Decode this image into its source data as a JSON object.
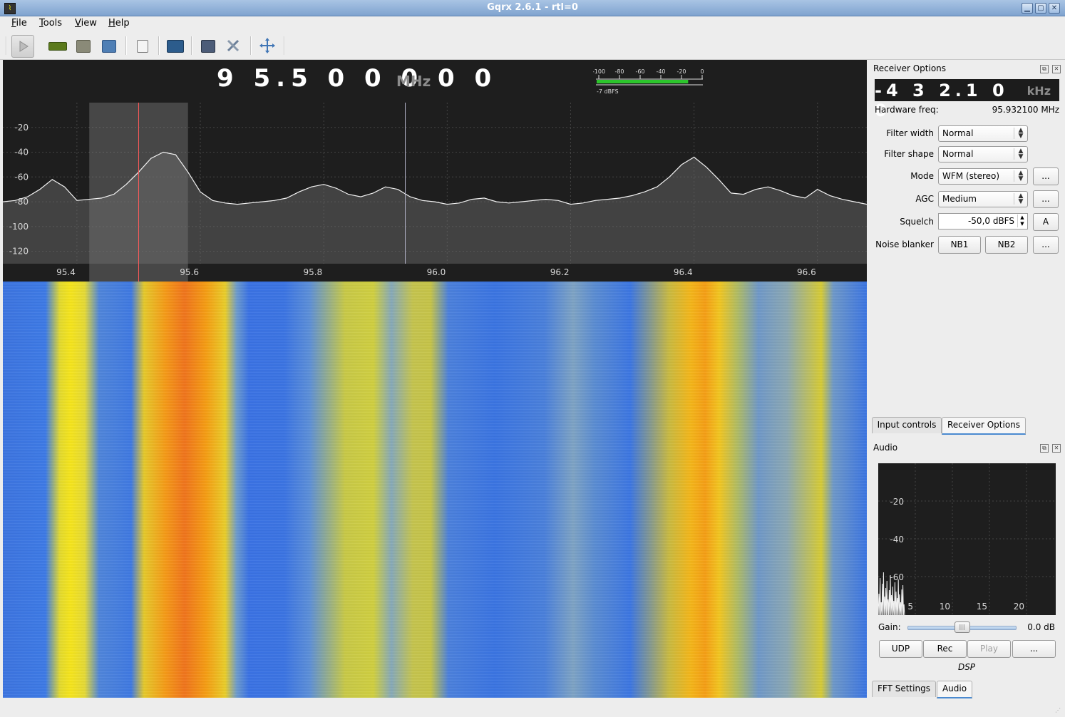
{
  "window": {
    "title": "Gqrx 2.6.1 - rtl=0",
    "controls": [
      "minimize-icon",
      "maximize-icon",
      "close-icon"
    ]
  },
  "menu": [
    "File",
    "Tools",
    "View",
    "Help"
  ],
  "toolbar": {
    "buttons": [
      "play-icon",
      "hardware-icon",
      "open-icon",
      "save-icon",
      "bookmark-icon",
      "dsp-icon",
      "remote-icon",
      "settings-icon",
      "fit-icon"
    ]
  },
  "plot": {
    "frequency": "9 5.5 0 0   0 0 0",
    "unit": "MHz",
    "meter": {
      "ticks": [
        "-100",
        "-80",
        "-60",
        "-40",
        "-20",
        "0"
      ],
      "level_label": "-7 dBFS",
      "level_dbfs": -7
    },
    "y_ticks": [
      "-20",
      "-40",
      "-60",
      "-80",
      "-100",
      "-120"
    ],
    "x_ticks": [
      "95.4",
      "95.6",
      "95.8",
      "96.0",
      "96.2",
      "96.4",
      "96.6"
    ]
  },
  "chart_data": {
    "type": "line",
    "x": [
      95.28,
      95.3,
      95.32,
      95.34,
      95.36,
      95.38,
      95.4,
      95.42,
      95.44,
      95.46,
      95.48,
      95.5,
      95.52,
      95.54,
      95.56,
      95.58,
      95.6,
      95.62,
      95.64,
      95.66,
      95.68,
      95.7,
      95.72,
      95.74,
      95.76,
      95.78,
      95.8,
      95.82,
      95.84,
      95.86,
      95.88,
      95.9,
      95.92,
      95.94,
      95.96,
      95.98,
      96.0,
      96.02,
      96.04,
      96.06,
      96.08,
      96.1,
      96.12,
      96.14,
      96.16,
      96.18,
      96.2,
      96.22,
      96.24,
      96.26,
      96.28,
      96.3,
      96.32,
      96.34,
      96.36,
      96.38,
      96.4,
      96.42,
      96.44,
      96.46,
      96.48,
      96.5,
      96.52,
      96.54,
      96.56,
      96.58,
      96.6,
      96.62,
      96.64,
      96.66,
      96.68
    ],
    "values": [
      -80,
      -79,
      -76,
      -70,
      -62,
      -68,
      -79,
      -78,
      -77,
      -74,
      -66,
      -56,
      -45,
      -40,
      -42,
      -56,
      -72,
      -79,
      -81,
      -82,
      -81,
      -80,
      -79,
      -77,
      -72,
      -68,
      -66,
      -69,
      -74,
      -76,
      -73,
      -68,
      -70,
      -76,
      -79,
      -80,
      -82,
      -81,
      -78,
      -77,
      -80,
      -81,
      -80,
      -79,
      -78,
      -79,
      -82,
      -81,
      -79,
      -78,
      -77,
      -75,
      -72,
      -68,
      -60,
      -50,
      -44,
      -52,
      -62,
      -73,
      -74,
      -70,
      -68,
      -71,
      -75,
      -77,
      -70,
      -75,
      -78,
      -80,
      -82
    ],
    "xlabel": "",
    "ylabel": "",
    "ylim": [
      -130,
      0
    ],
    "xlim": [
      95.28,
      96.68
    ],
    "grid": true
  },
  "receiver": {
    "title": "Receiver Options",
    "offset": "-4 3 2.1 0 0",
    "offset_unit": "kHz",
    "hw_label": "Hardware freq:",
    "hw_value": "95.932100 MHz",
    "filter_width_label": "Filter width",
    "filter_width": "Normal",
    "filter_shape_label": "Filter shape",
    "filter_shape": "Normal",
    "mode_label": "Mode",
    "mode": "WFM (stereo)",
    "agc_label": "AGC",
    "agc": "Medium",
    "squelch_label": "Squelch",
    "squelch": "-50,0 dBFS",
    "squelch_btn": "A",
    "nb_label": "Noise blanker",
    "nb1": "NB1",
    "nb2": "NB2",
    "more": "..."
  },
  "tabs_top": [
    "Input controls",
    "Receiver Options"
  ],
  "audio": {
    "title": "Audio",
    "y_ticks": [
      "-20",
      "-40",
      "-60"
    ],
    "x_ticks": [
      "5",
      "10",
      "15",
      "20"
    ],
    "gain_label": "Gain:",
    "gain_value": "0.0 dB",
    "gain_fraction": 0.5,
    "udp": "UDP",
    "rec": "Rec",
    "play": "Play",
    "more": "...",
    "dsp": "DSP"
  },
  "tabs_bottom": [
    "FFT Settings",
    "Audio"
  ]
}
